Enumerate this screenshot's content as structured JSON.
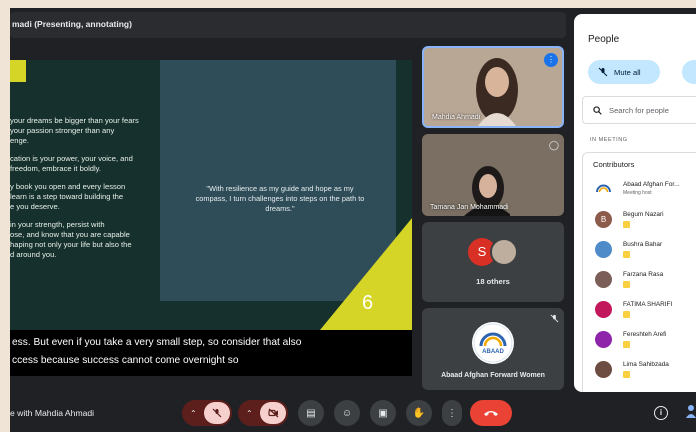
{
  "presenter_label": "madi (Presenting, annotating)",
  "slide": {
    "left_paragraphs": [
      "your dreams be bigger than your fears\nyour passion stronger than any\nenge.",
      "cation is your power, your voice, and\nfreedom, embrace it boldly.",
      "y book you open and every lesson\nlearn is a step toward building the\ne you deserve.",
      "in your strength, persist with\nose, and know that you are capable\nhaping not only your life but also the\nd around you."
    ],
    "quote": "\"With resilience as my guide and hope as my compass, I turn challenges into steps on the path to dreams.\"",
    "number": "6"
  },
  "captions": [
    "ess. But even if you take a very small step, so consider that also",
    "ccess because success cannot come overnight so"
  ],
  "tiles": [
    {
      "name": "Mahdia Ahmadi"
    },
    {
      "name": "Tamana Jan Mohammadi"
    },
    {
      "avatar_letter": "S",
      "label": "18 others"
    },
    {
      "name": "Abaad Afghan Forward Women",
      "logo_text": "ABAAD"
    }
  ],
  "meeting_title": "e with Mahdia Ahmadi",
  "controls": {
    "hangup_color": "#ea4335"
  },
  "people": {
    "title": "People",
    "mute_all": "Mute all",
    "search_placeholder": "Search for people",
    "section": "IN MEETING",
    "group": "Contributors",
    "participants": [
      {
        "name": "Abaad Afghan For...",
        "sub": "Meeting host",
        "color": "#1a73e8",
        "letter": ""
      },
      {
        "name": "Begum Nazari",
        "sub": "",
        "color": "#8d5b4c",
        "letter": "B"
      },
      {
        "name": "Bushra Bahar",
        "sub": "",
        "color": "#4f8bc9",
        "letter": ""
      },
      {
        "name": "Farzana Rasa",
        "sub": "",
        "color": "#7b5e57",
        "letter": ""
      },
      {
        "name": "FATIMA SHARIFI",
        "sub": "",
        "color": "#c2185b",
        "letter": ""
      },
      {
        "name": "Fereshteh Arefi",
        "sub": "",
        "color": "#8e24aa",
        "letter": ""
      },
      {
        "name": "Lima Sahibzada",
        "sub": "",
        "color": "#6d4c41",
        "letter": ""
      }
    ]
  }
}
